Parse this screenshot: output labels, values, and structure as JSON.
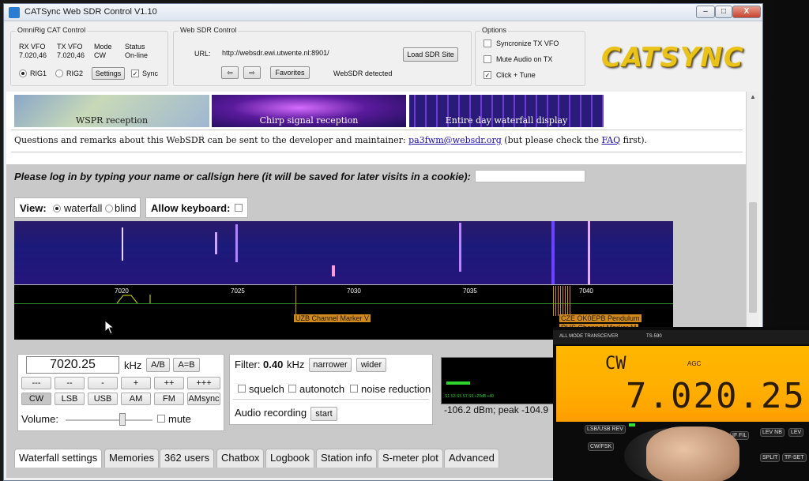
{
  "window": {
    "title": "CATSync Web SDR Control V1.10",
    "min": "–",
    "max": "□",
    "close": "X"
  },
  "omnirig": {
    "title": "OmniRig CAT Control",
    "rx_label": "RX VFO",
    "rx_value": "7.020,46",
    "tx_label": "TX VFO",
    "tx_value": "7.020,46",
    "mode_label": "Mode",
    "mode_value": "CW",
    "status_label": "Status",
    "status_value": "On-line",
    "rig1": "RIG1",
    "rig2": "RIG2",
    "settings": "Settings",
    "sync": "Sync"
  },
  "websdr_ctrl": {
    "title": "Web SDR Control",
    "url_label": "URL:",
    "url_value": "http://websdr.ewi.utwente.nl:8901/",
    "load": "Load SDR Site",
    "back": "⇦",
    "forward": "⇨",
    "favorites": "Favorites",
    "detected": "WebSDR detected"
  },
  "options": {
    "title": "Options",
    "sync_tx": "Syncronize TX VFO",
    "mute": "Mute Audio on TX",
    "click_tune": "Click + Tune"
  },
  "logo": "CATSYNC",
  "page": {
    "thumb1": "WSPR reception",
    "thumb2": "Chirp signal reception",
    "thumb3": "Entire day waterfall display",
    "remarks": "Questions and remarks about this WebSDR can be sent to the developer and maintainer:",
    "email": "pa3fwm@websdr.org",
    "remarks2": "(but please check the",
    "faq": "FAQ",
    "remarks3": "first).",
    "login": "Please log in by typing your name or callsign here (it will be saved for later visits in a cookie):",
    "view_label": "View:",
    "view_waterfall": "waterfall",
    "view_blind": "blind",
    "keyboard": "Allow keyboard:"
  },
  "waterfall": {
    "ticks": [
      "7020",
      "7025",
      "7030",
      "7035",
      "7040"
    ],
    "marker1": "UZB Channel Marker V",
    "marker2": "CZE OK0EPB Pendulum",
    "marker3": "RUS Channel Marker M"
  },
  "tuning": {
    "freq": "7020.25",
    "unit": "kHz",
    "ab": "A/B",
    "aeqb": "A=B",
    "steps": [
      "---",
      "--",
      "-",
      "+",
      "++",
      "+++"
    ],
    "modes": [
      "CW",
      "LSB",
      "USB",
      "AM",
      "FM",
      "AMsync"
    ],
    "volume": "Volume:",
    "mute": "mute"
  },
  "filter": {
    "label": "Filter:",
    "value": "0.40",
    "unit": "kHz",
    "narrower": "narrower",
    "wider": "wider",
    "squelch": "squelch",
    "autonotch": "autonotch",
    "noise": "noise reduction",
    "recording": "Audio recording",
    "start": "start"
  },
  "smeter": {
    "scale": "S1  S3  S5  S7  S9  +20dB  +40",
    "reading": "-106.2 dBm; peak -104.9"
  },
  "tabs": [
    "Waterfall settings",
    "Memories",
    "362 users",
    "Chatbox",
    "Logbook",
    "Station info",
    "S-meter plot",
    "Advanced"
  ],
  "radio": {
    "brand": "ALL MODE TRANSCEIVER",
    "model": "TS-590",
    "mode": "CW",
    "agc": "AGC",
    "freq": "7.020.25",
    "keys": [
      "LSB/USB REV",
      "CW/FSK",
      "IF FIL",
      "LEV NB",
      "LEV",
      "SPLIT",
      "TF-SET"
    ]
  }
}
